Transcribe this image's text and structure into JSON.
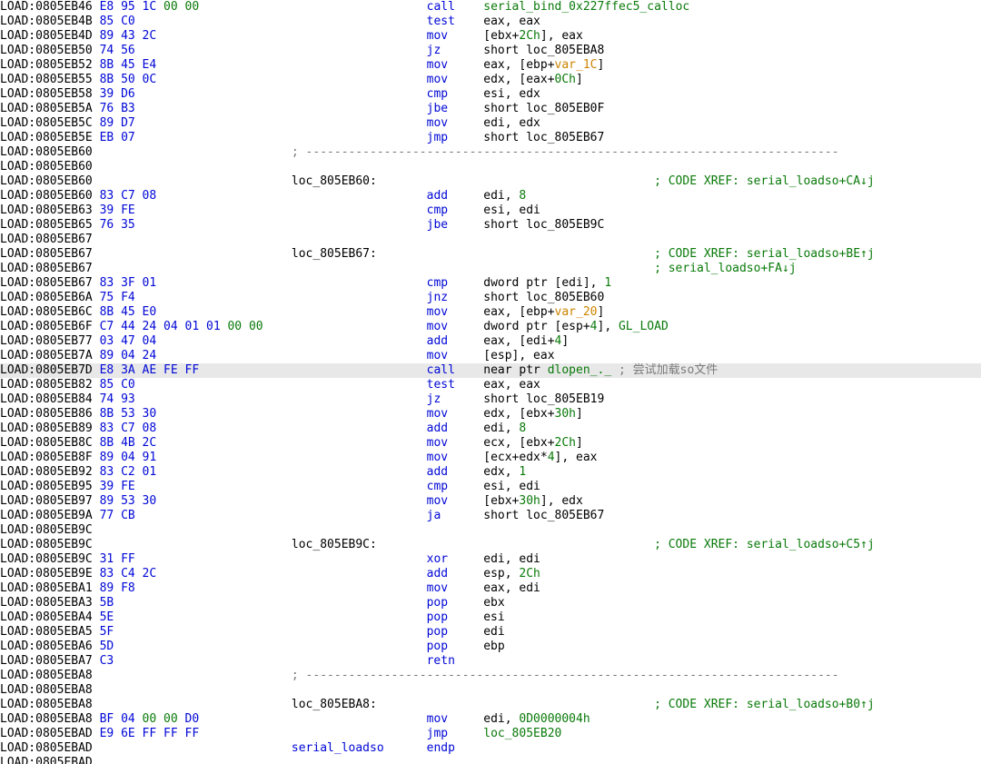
{
  "cols": {
    "addr_w": 14,
    "bytes_w": 27,
    "label_w": 19,
    "mnem_w": 8,
    "ops_w": 24
  },
  "lines": [
    {
      "addr": "LOAD:0805EB46",
      "bytes": "E8 95 1C 00 00",
      "mnemonic": "call",
      "ops": [
        {
          "t": "tgt",
          "v": "serial_bind_0x227ffec5_calloc"
        }
      ]
    },
    {
      "addr": "LOAD:0805EB4B",
      "bytes": "85 C0",
      "mnemonic": "test",
      "ops": [
        {
          "t": "txt",
          "v": "eax, eax"
        }
      ]
    },
    {
      "addr": "LOAD:0805EB4D",
      "bytes": "89 43 2C",
      "mnemonic": "mov",
      "ops": [
        {
          "t": "txt",
          "v": "[ebx+"
        },
        {
          "t": "tgt",
          "v": "2Ch"
        },
        {
          "t": "txt",
          "v": "], eax"
        }
      ]
    },
    {
      "addr": "LOAD:0805EB50",
      "bytes": "74 56",
      "mnemonic": "jz",
      "ops": [
        {
          "t": "txt",
          "v": "short loc_805EBA8"
        }
      ]
    },
    {
      "addr": "LOAD:0805EB52",
      "bytes": "8B 45 E4",
      "mnemonic": "mov",
      "ops": [
        {
          "t": "txt",
          "v": "eax, [ebp+"
        },
        {
          "t": "var",
          "v": "var_1C"
        },
        {
          "t": "txt",
          "v": "]"
        }
      ]
    },
    {
      "addr": "LOAD:0805EB55",
      "bytes": "8B 50 0C",
      "mnemonic": "mov",
      "ops": [
        {
          "t": "txt",
          "v": "edx, [eax+"
        },
        {
          "t": "tgt",
          "v": "0Ch"
        },
        {
          "t": "txt",
          "v": "]"
        }
      ]
    },
    {
      "addr": "LOAD:0805EB58",
      "bytes": "39 D6",
      "mnemonic": "cmp",
      "ops": [
        {
          "t": "txt",
          "v": "esi, edx"
        }
      ]
    },
    {
      "addr": "LOAD:0805EB5A",
      "bytes": "76 B3",
      "mnemonic": "jbe",
      "ops": [
        {
          "t": "txt",
          "v": "short loc_805EB0F"
        }
      ]
    },
    {
      "addr": "LOAD:0805EB5C",
      "bytes": "89 D7",
      "mnemonic": "mov",
      "ops": [
        {
          "t": "txt",
          "v": "edi, edx"
        }
      ]
    },
    {
      "addr": "LOAD:0805EB5E",
      "bytes": "EB 07",
      "mnemonic": "jmp",
      "ops": [
        {
          "t": "txt",
          "v": "short loc_805EB67"
        }
      ]
    },
    {
      "addr": "LOAD:0805EB60",
      "dash": true
    },
    {
      "addr": "LOAD:0805EB60"
    },
    {
      "addr": "LOAD:0805EB60",
      "label": "loc_805EB60:",
      "xref": "; CODE XREF: serial_loadso+CA↓j"
    },
    {
      "addr": "LOAD:0805EB60",
      "bytes": "83 C7 08",
      "mnemonic": "add",
      "ops": [
        {
          "t": "txt",
          "v": "edi, "
        },
        {
          "t": "tgt",
          "v": "8"
        }
      ]
    },
    {
      "addr": "LOAD:0805EB63",
      "bytes": "39 FE",
      "mnemonic": "cmp",
      "ops": [
        {
          "t": "txt",
          "v": "esi, edi"
        }
      ]
    },
    {
      "addr": "LOAD:0805EB65",
      "bytes": "76 35",
      "mnemonic": "jbe",
      "ops": [
        {
          "t": "txt",
          "v": "short loc_805EB9C"
        }
      ]
    },
    {
      "addr": "LOAD:0805EB67"
    },
    {
      "addr": "LOAD:0805EB67",
      "label": "loc_805EB67:",
      "xref": "; CODE XREF: serial_loadso+BE↑j"
    },
    {
      "addr": "LOAD:0805EB67",
      "xref": "; serial_loadso+FA↓j"
    },
    {
      "addr": "LOAD:0805EB67",
      "bytes": "83 3F 01",
      "mnemonic": "cmp",
      "ops": [
        {
          "t": "txt",
          "v": "dword ptr [edi], "
        },
        {
          "t": "tgt",
          "v": "1"
        }
      ]
    },
    {
      "addr": "LOAD:0805EB6A",
      "bytes": "75 F4",
      "mnemonic": "jnz",
      "ops": [
        {
          "t": "txt",
          "v": "short loc_805EB60"
        }
      ]
    },
    {
      "addr": "LOAD:0805EB6C",
      "bytes": "8B 45 E0",
      "mnemonic": "mov",
      "ops": [
        {
          "t": "txt",
          "v": "eax, [ebp+"
        },
        {
          "t": "var",
          "v": "var_20"
        },
        {
          "t": "txt",
          "v": "]"
        }
      ]
    },
    {
      "addr": "LOAD:0805EB6F",
      "bytes": "C7 44 24 04 01 01 00 00",
      "mnemonic": "mov",
      "ops": [
        {
          "t": "txt",
          "v": "dword ptr [esp+"
        },
        {
          "t": "tgt",
          "v": "4"
        },
        {
          "t": "txt",
          "v": "], "
        },
        {
          "t": "tgt",
          "v": "GL_LOAD"
        }
      ]
    },
    {
      "addr": "LOAD:0805EB77",
      "bytes": "03 47 04",
      "mnemonic": "add",
      "ops": [
        {
          "t": "txt",
          "v": "eax, [edi+"
        },
        {
          "t": "tgt",
          "v": "4"
        },
        {
          "t": "txt",
          "v": "]"
        }
      ]
    },
    {
      "addr": "LOAD:0805EB7A",
      "bytes": "89 04 24",
      "mnemonic": "mov",
      "ops": [
        {
          "t": "txt",
          "v": "[esp], eax"
        }
      ]
    },
    {
      "addr": "LOAD:0805EB7D",
      "bytes": "E8 3A AE FE FF",
      "hl": true,
      "mnemonic": "call",
      "ops": [
        {
          "t": "txt",
          "v": "near ptr "
        },
        {
          "t": "tgt",
          "v": "dlopen_._"
        },
        {
          "t": "txt",
          "v": " "
        },
        {
          "t": "cmt",
          "v": "; 尝试加载so文件"
        }
      ]
    },
    {
      "addr": "LOAD:0805EB82",
      "bytes": "85 C0",
      "mnemonic": "test",
      "ops": [
        {
          "t": "txt",
          "v": "eax, eax"
        }
      ]
    },
    {
      "addr": "LOAD:0805EB84",
      "bytes": "74 93",
      "mnemonic": "jz",
      "ops": [
        {
          "t": "txt",
          "v": "short loc_805EB19"
        }
      ]
    },
    {
      "addr": "LOAD:0805EB86",
      "bytes": "8B 53 30",
      "mnemonic": "mov",
      "ops": [
        {
          "t": "txt",
          "v": "edx, [ebx+"
        },
        {
          "t": "tgt",
          "v": "30h"
        },
        {
          "t": "txt",
          "v": "]"
        }
      ]
    },
    {
      "addr": "LOAD:0805EB89",
      "bytes": "83 C7 08",
      "mnemonic": "add",
      "ops": [
        {
          "t": "txt",
          "v": "edi, "
        },
        {
          "t": "tgt",
          "v": "8"
        }
      ]
    },
    {
      "addr": "LOAD:0805EB8C",
      "bytes": "8B 4B 2C",
      "mnemonic": "mov",
      "ops": [
        {
          "t": "txt",
          "v": "ecx, [ebx+"
        },
        {
          "t": "tgt",
          "v": "2Ch"
        },
        {
          "t": "txt",
          "v": "]"
        }
      ]
    },
    {
      "addr": "LOAD:0805EB8F",
      "bytes": "89 04 91",
      "mnemonic": "mov",
      "ops": [
        {
          "t": "txt",
          "v": "[ecx+edx*"
        },
        {
          "t": "tgt",
          "v": "4"
        },
        {
          "t": "txt",
          "v": "], eax"
        }
      ]
    },
    {
      "addr": "LOAD:0805EB92",
      "bytes": "83 C2 01",
      "mnemonic": "add",
      "ops": [
        {
          "t": "txt",
          "v": "edx, "
        },
        {
          "t": "tgt",
          "v": "1"
        }
      ]
    },
    {
      "addr": "LOAD:0805EB95",
      "bytes": "39 FE",
      "mnemonic": "cmp",
      "ops": [
        {
          "t": "txt",
          "v": "esi, edi"
        }
      ]
    },
    {
      "addr": "LOAD:0805EB97",
      "bytes": "89 53 30",
      "mnemonic": "mov",
      "ops": [
        {
          "t": "txt",
          "v": "[ebx+"
        },
        {
          "t": "tgt",
          "v": "30h"
        },
        {
          "t": "txt",
          "v": "], edx"
        }
      ]
    },
    {
      "addr": "LOAD:0805EB9A",
      "bytes": "77 CB",
      "mnemonic": "ja",
      "ops": [
        {
          "t": "txt",
          "v": "short loc_805EB67"
        }
      ]
    },
    {
      "addr": "LOAD:0805EB9C"
    },
    {
      "addr": "LOAD:0805EB9C",
      "label": "loc_805EB9C:",
      "xref": "; CODE XREF: serial_loadso+C5↑j"
    },
    {
      "addr": "LOAD:0805EB9C",
      "bytes": "31 FF",
      "mnemonic": "xor",
      "ops": [
        {
          "t": "txt",
          "v": "edi, edi"
        }
      ]
    },
    {
      "addr": "LOAD:0805EB9E",
      "bytes": "83 C4 2C",
      "mnemonic": "add",
      "ops": [
        {
          "t": "txt",
          "v": "esp, "
        },
        {
          "t": "tgt",
          "v": "2Ch"
        }
      ]
    },
    {
      "addr": "LOAD:0805EBA1",
      "bytes": "89 F8",
      "mnemonic": "mov",
      "ops": [
        {
          "t": "txt",
          "v": "eax, edi"
        }
      ]
    },
    {
      "addr": "LOAD:0805EBA3",
      "bytes": "5B",
      "mnemonic": "pop",
      "ops": [
        {
          "t": "txt",
          "v": "ebx"
        }
      ]
    },
    {
      "addr": "LOAD:0805EBA4",
      "bytes": "5E",
      "mnemonic": "pop",
      "ops": [
        {
          "t": "txt",
          "v": "esi"
        }
      ]
    },
    {
      "addr": "LOAD:0805EBA5",
      "bytes": "5F",
      "mnemonic": "pop",
      "ops": [
        {
          "t": "txt",
          "v": "edi"
        }
      ]
    },
    {
      "addr": "LOAD:0805EBA6",
      "bytes": "5D",
      "mnemonic": "pop",
      "ops": [
        {
          "t": "txt",
          "v": "ebp"
        }
      ]
    },
    {
      "addr": "LOAD:0805EBA7",
      "bytes": "C3",
      "mnemonic": "retn"
    },
    {
      "addr": "LOAD:0805EBA8",
      "dash": true
    },
    {
      "addr": "LOAD:0805EBA8"
    },
    {
      "addr": "LOAD:0805EBA8",
      "label": "loc_805EBA8:",
      "xref": "; CODE XREF: serial_loadso+B0↑j"
    },
    {
      "addr": "LOAD:0805EBA8",
      "bytes": "BF 04 00 00 D0",
      "mnemonic": "mov",
      "ops": [
        {
          "t": "txt",
          "v": "edi, "
        },
        {
          "t": "tgt",
          "v": "0D0000004h"
        }
      ]
    },
    {
      "addr": "LOAD:0805EBAD",
      "bytes": "E9 6E FF FF FF",
      "mnemonic": "jmp",
      "ops": [
        {
          "t": "tgt",
          "v": "loc_805EB20"
        }
      ]
    },
    {
      "addr": "LOAD:0805EBAD",
      "label": "serial_loadso",
      "mnemonic": "endp",
      "blueLabel": true
    },
    {
      "addr": "LOAD:0805EBAD"
    }
  ]
}
